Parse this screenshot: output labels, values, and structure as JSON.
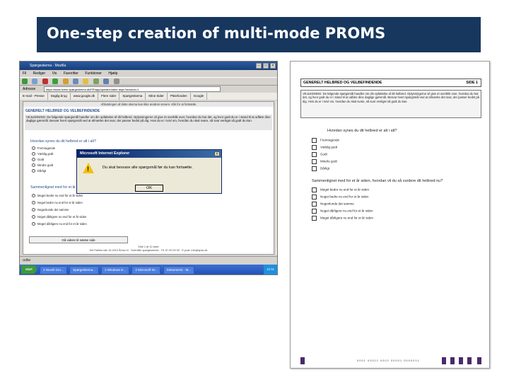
{
  "slide": {
    "title": "One-step creation of multi-mode PROMS"
  },
  "browser": {
    "window_title": "Spørgeskema - Mozilla",
    "menu": [
      "Fil",
      "Rediger",
      "Vis",
      "Favoritter",
      "Funktioner",
      "Hjælp"
    ],
    "address_label": "Adresse",
    "address_value": "https://www.hvem.spørgeskema.dk/PR/app/questionnaire.aspx?session=1",
    "tabs": [
      "E-mail - Presse",
      "Daglig brug",
      "www.google.dk",
      "Flere sider",
      "Spørgeskema",
      "Mine Sider",
      "Pleiefonden",
      "Google"
    ],
    "notice": "Afslutningen af dette skema kan ikke ændres senere. Klik for at fortsætte",
    "section_title": "GENERELT HELBRED OG VELBEFINDENDE",
    "instruction": "VEJLEDNING: De følgende spørgsmål handler om din opfattelse af dit helbred. Oplysningerne vil give et overblik over, hvordan du har det, og hvor godt du er i stand til at udføre dine daglige gøremål. Besvar hvert spørgsmål ved at afmærke det svar, der passer bedst på dig. Hvis du er i tvivl om, hvordan du skal svare, så svar venligst så godt du kan.",
    "q1": "Hvordan synes du dit helbred er alt i alt?",
    "q1_options": [
      "Fremragende",
      "Vældig godt",
      "Godt",
      "Mindre godt",
      "Dårligt"
    ],
    "q2": "Sammenlignet med for et år siden",
    "q2_options": [
      "Meget bedre nu end for et år siden",
      "Noget bedre nu end for et år siden",
      "Nogenlunde det samme",
      "Noget dårligere nu end for et år siden",
      "Meget dårligere nu end for et år siden"
    ],
    "next_button": "Gå videre til næste side",
    "footer_line1": "Side 1 af 12 sider",
    "footer_line2": "Det Fælles site 15-2010 Århus N · Scientific spørgeskema · Tlf: 87 00 00 00 · E-post: info@spss.dk",
    "status": "Udfør",
    "start_label": "start",
    "taskbar_items": [
      "2 Novell Gro...",
      "Spørgeskema...",
      "2 Windows E...",
      "2 Microsoft W...",
      "Dokument1 - M..."
    ],
    "tray_time": "12:11"
  },
  "dialog": {
    "title": "Microsoft Internet Explorer",
    "message": "Du skal besvare alle spørgsmål før du kan fortsætte.",
    "ok": "OK"
  },
  "paper": {
    "header": "GENERELT HELBRED OG VELBEFINDENDE",
    "page_label": "SIDE 1",
    "instruction": "VEJLEDNING: De følgende spørgsmål handler om din opfattelse af dit helbred. Oplysningerne vil give et overblik over, hvordan du har det, og hvor godt du er i stand til at udføre dine daglige gøremål. Besvar hvert spørgsmål ved at afmærke det svar, der passer bedst på dig. Hvis du er i tvivl om, hvordan du skal svare, så svar venligst så godt du kan.",
    "q1": "Hvordan synes du dit helbred er alt i alt?",
    "q1_options": [
      "Fremragende",
      "Vældig godt",
      "Godt",
      "Mindre godt",
      "Dårligt"
    ],
    "q2": "Sammenlignet med for et år siden, hvordan vil du så vurdere dit helbred nu?",
    "q2_options": [
      "Meget bedre nu end for et år siden",
      "Noget bedre nu end for et år siden",
      "Nogenlunde det samme",
      "Noget dårligere nu end for et år siden",
      "Meget dårligere nu end for et år siden"
    ],
    "footer_code": "0001 00011 0002 00001 0000011"
  }
}
